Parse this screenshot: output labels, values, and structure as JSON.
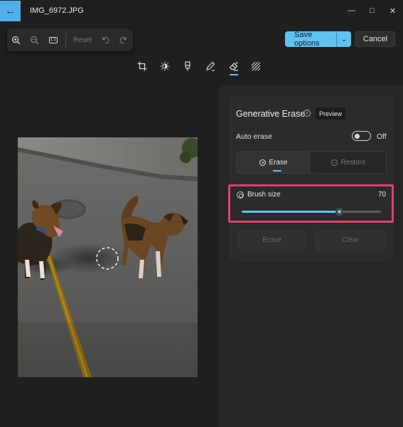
{
  "titlebar": {
    "filename": "IMG_6972.JPG",
    "back_icon": "arrow-left-icon",
    "controls": [
      "minimize-icon",
      "maximize-icon",
      "close-icon"
    ]
  },
  "zoom_toolbar": {
    "zoom_in_icon": "zoom-in-icon",
    "zoom_out_icon": "zoom-out-icon",
    "actual_size_label": "1:1",
    "reset_label": "Reset",
    "undo_icon": "undo-icon",
    "redo_icon": "redo-icon"
  },
  "actions": {
    "save_label": "Save options",
    "cancel_label": "Cancel"
  },
  "tools": [
    {
      "name": "crop-icon"
    },
    {
      "name": "adjust-icon"
    },
    {
      "name": "filter-icon"
    },
    {
      "name": "markup-icon"
    },
    {
      "name": "erase-icon",
      "active": true
    },
    {
      "name": "background-icon"
    }
  ],
  "panel": {
    "title": "Generative Erase",
    "preview_label": "Preview",
    "auto_erase_label": "Auto erase",
    "auto_erase_state": "Off",
    "auto_erase_on": false,
    "modes": {
      "erase_label": "Erase",
      "restore_label": "Restore",
      "selected": "Erase"
    },
    "brush_size_label": "Brush size",
    "brush_size_value": "70",
    "brush_size_min": 0,
    "brush_size_max": 100,
    "erase_button_label": "Erase",
    "clear_button_label": "Clear"
  },
  "colors": {
    "accent": "#60c2ef",
    "highlight_box": "#e43d6e",
    "background": "#1f1f1f"
  }
}
